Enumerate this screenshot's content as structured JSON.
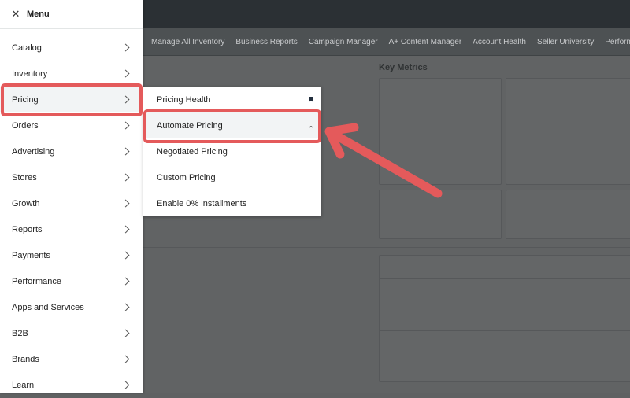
{
  "menu": {
    "title": "Menu"
  },
  "nav": [
    "Manage All Inventory",
    "Business Reports",
    "Campaign Manager",
    "A+ Content Manager",
    "Account Health",
    "Seller University",
    "Performance"
  ],
  "dashboard": {
    "metrics_title": "Key Metrics"
  },
  "sidebar": {
    "items": [
      {
        "label": "Catalog"
      },
      {
        "label": "Inventory"
      },
      {
        "label": "Pricing"
      },
      {
        "label": "Orders"
      },
      {
        "label": "Advertising"
      },
      {
        "label": "Stores"
      },
      {
        "label": "Growth"
      },
      {
        "label": "Reports"
      },
      {
        "label": "Payments"
      },
      {
        "label": "Performance"
      },
      {
        "label": "Apps and Services"
      },
      {
        "label": "B2B"
      },
      {
        "label": "Brands"
      },
      {
        "label": "Learn"
      }
    ]
  },
  "submenu": {
    "items": [
      {
        "label": "Pricing Health",
        "bookmark": "bookmark-filled-icon"
      },
      {
        "label": "Automate Pricing",
        "bookmark": "bookmark-outline-icon"
      },
      {
        "label": "Negotiated Pricing"
      },
      {
        "label": "Custom Pricing"
      },
      {
        "label": "Enable 0% installments"
      }
    ]
  },
  "colors": {
    "highlight": "#e45a5b",
    "topbar": "#2b3034",
    "overlay": "#616364"
  }
}
